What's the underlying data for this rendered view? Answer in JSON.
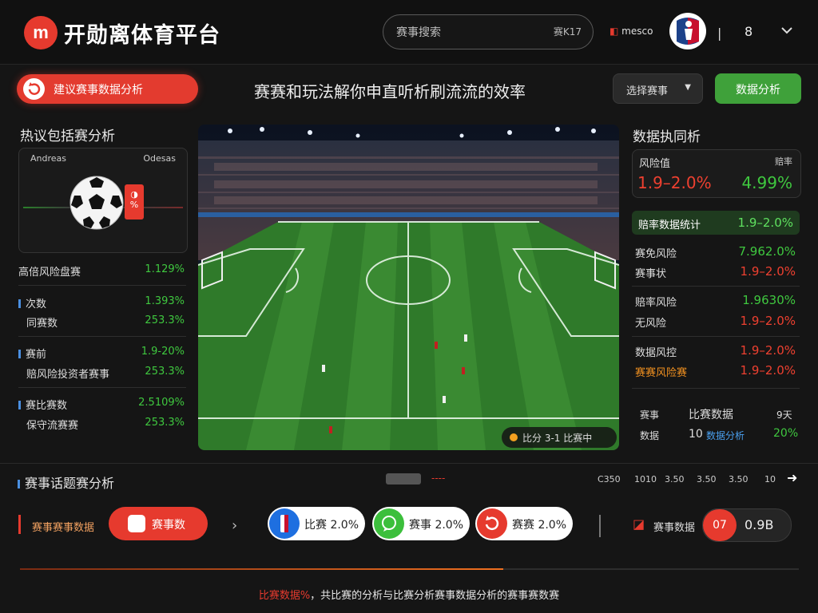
{
  "header": {
    "logo_mark": "m",
    "title": "开勋离体育平台",
    "search_placeholder": "赛事搜索",
    "search_hint": "赛K17",
    "brand_prefix": "",
    "brand_name": "mesco",
    "separator": "|",
    "user_label": "8"
  },
  "toolbar": {
    "promo_label": "建议赛事数据分析",
    "headline": "赛赛和玩法解你申直听析刷流流的效率",
    "select_label": "选择赛事",
    "analyze_label": "数据分析"
  },
  "left_panel": {
    "title": "热议包括赛分析",
    "card_tabs": [
      "Andreas",
      "Odesas"
    ],
    "red_tag": "%",
    "rows": [
      {
        "label": "高倍风险盘赛",
        "value": "1.129%"
      },
      {
        "label": "次数",
        "value": "1.393%"
      },
      {
        "label": "同赛数",
        "value": "253.3%"
      },
      {
        "label": "赛前",
        "value": "1.9-20%"
      },
      {
        "label": "赔风险投资者赛事",
        "value": "253.3%"
      },
      {
        "label": "赛比赛数",
        "value": "2.5109%"
      },
      {
        "label": "保守流赛赛",
        "value": "253.3%"
      }
    ]
  },
  "center": {
    "live_text": "比分 3-1 比赛中"
  },
  "right_panel": {
    "title": "数据执同析",
    "card": {
      "label1": "风险值",
      "label2": "赔率",
      "value1": "1.9–2.0%",
      "value2": "4.99%"
    },
    "highlight": {
      "label": "赔率数据统计",
      "value": "1.9–2.0%"
    },
    "rows": [
      {
        "label": "赛免风险",
        "value": "7.962.0%",
        "tone": "green"
      },
      {
        "label": "赛事状",
        "value": "1.9–2.0%",
        "tone": "red"
      },
      {
        "label": "赔率风险",
        "value": "1.9630%",
        "tone": "green"
      },
      {
        "label": "无风险",
        "value": "1.9–2.0%",
        "tone": "red"
      },
      {
        "label": "数据风控",
        "value": "1.9–2.0%",
        "tone": "red"
      },
      {
        "label": "赛赛风险赛",
        "value": "1.9–2.0%",
        "tone": "red",
        "label_tone": "orange"
      }
    ],
    "mini": {
      "c1": "赛事",
      "c2": "比赛数据",
      "c3": "9天",
      "d1": "数据",
      "d2": "10",
      "d3": "数据分析",
      "d4": "20%"
    }
  },
  "section": {
    "title": "赛事话题赛分析",
    "dash": "----",
    "pages": [
      "C350",
      "1010",
      "3.50",
      "3.50",
      "3.50",
      "10"
    ]
  },
  "strip": {
    "label": "赛事赛事数据",
    "button_label": "赛事数",
    "pills": [
      {
        "label": "比赛 2.0%",
        "color": "#1e6fe0"
      },
      {
        "label": "赛事 2.0%",
        "color": "#3cbf3c"
      },
      {
        "label": "赛赛 2.0%",
        "color": "#e63a2e"
      }
    ],
    "ticker_label": "赛事数据",
    "rank": "07",
    "score": "0.9B"
  },
  "footer": {
    "highlight": "比赛数据%",
    "text": "，共比赛的分析与比赛分析赛事数据分析的赛事赛数赛",
    "progress": 0.62
  },
  "colors": {
    "accent": "#e63a2e",
    "positive": "#3fc83f",
    "background": "#151515"
  }
}
